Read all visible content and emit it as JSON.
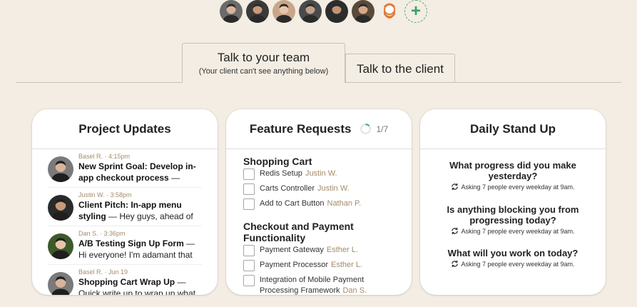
{
  "people": [
    {
      "name": "person-1",
      "color": "#6b6b6b"
    },
    {
      "name": "person-2",
      "color": "#3a3a3a"
    },
    {
      "name": "person-3",
      "color": "#c9a58a"
    },
    {
      "name": "person-4",
      "color": "#4a4a4a"
    },
    {
      "name": "person-5",
      "color": "#2d2d2d"
    },
    {
      "name": "person-6",
      "color": "#5a4a3a"
    },
    {
      "name": "person-7",
      "color": "#e07a3a"
    }
  ],
  "add_person_symbol": "+",
  "tabs": {
    "team": {
      "title": "Talk to your team",
      "subtitle": "(Your client can't see anything below)"
    },
    "client": {
      "title": "Talk to the client"
    }
  },
  "project_updates": {
    "title": "Project Updates",
    "items": [
      {
        "meta": "Basel R. · 4:15pm",
        "title": "New Sprint Goal: Develop in-app checkout process",
        "snippet": " —"
      },
      {
        "meta": "Justin W. · 3:58pm",
        "title": "Client Pitch: In-app menu styling",
        "snippet": " — Hey guys, ahead of"
      },
      {
        "meta": "Dan S. · 3:36pm",
        "title": "A/B Testing Sign Up Form",
        "snippet": " — Hi everyone! I'm adamant that"
      },
      {
        "meta": "Basel R. · Jun 19",
        "title": "Shopping Cart Wrap Up",
        "snippet": " — Quick write up to wrap up what"
      }
    ]
  },
  "feature_requests": {
    "title": "Feature Requests",
    "progress_label": "1/7",
    "progress_fraction": 0.14,
    "groups": [
      {
        "title": "Shopping Cart",
        "items": [
          {
            "label": "Redis Setup",
            "assignee": "Justin W."
          },
          {
            "label": "Carts Controller",
            "assignee": "Justin W."
          },
          {
            "label": "Add to Cart Button",
            "assignee": "Nathan P."
          }
        ]
      },
      {
        "title": "Checkout and Payment Functionality",
        "items": [
          {
            "label": "Payment Gateway",
            "assignee": "Esther L."
          },
          {
            "label": "Payment Processor",
            "assignee": "Esther L."
          },
          {
            "label": "Integration of Mobile Payment Processing Framework",
            "assignee": "Dan S."
          }
        ]
      }
    ]
  },
  "daily_standup": {
    "title": "Daily Stand Up",
    "questions": [
      {
        "title": "What progress did you make yesterday?",
        "schedule": "Asking 7 people every weekday at 9am."
      },
      {
        "title": "Is anything blocking you from progressing today?",
        "schedule": "Asking 7 people every weekday at 9am."
      },
      {
        "title": "What will you work on today?",
        "schedule": "Asking 7 people every weekday at 9am."
      }
    ]
  },
  "colors": {
    "background": "#f3ede3",
    "accent_green": "#3aa064",
    "meta_brown": "#a38b6b"
  }
}
